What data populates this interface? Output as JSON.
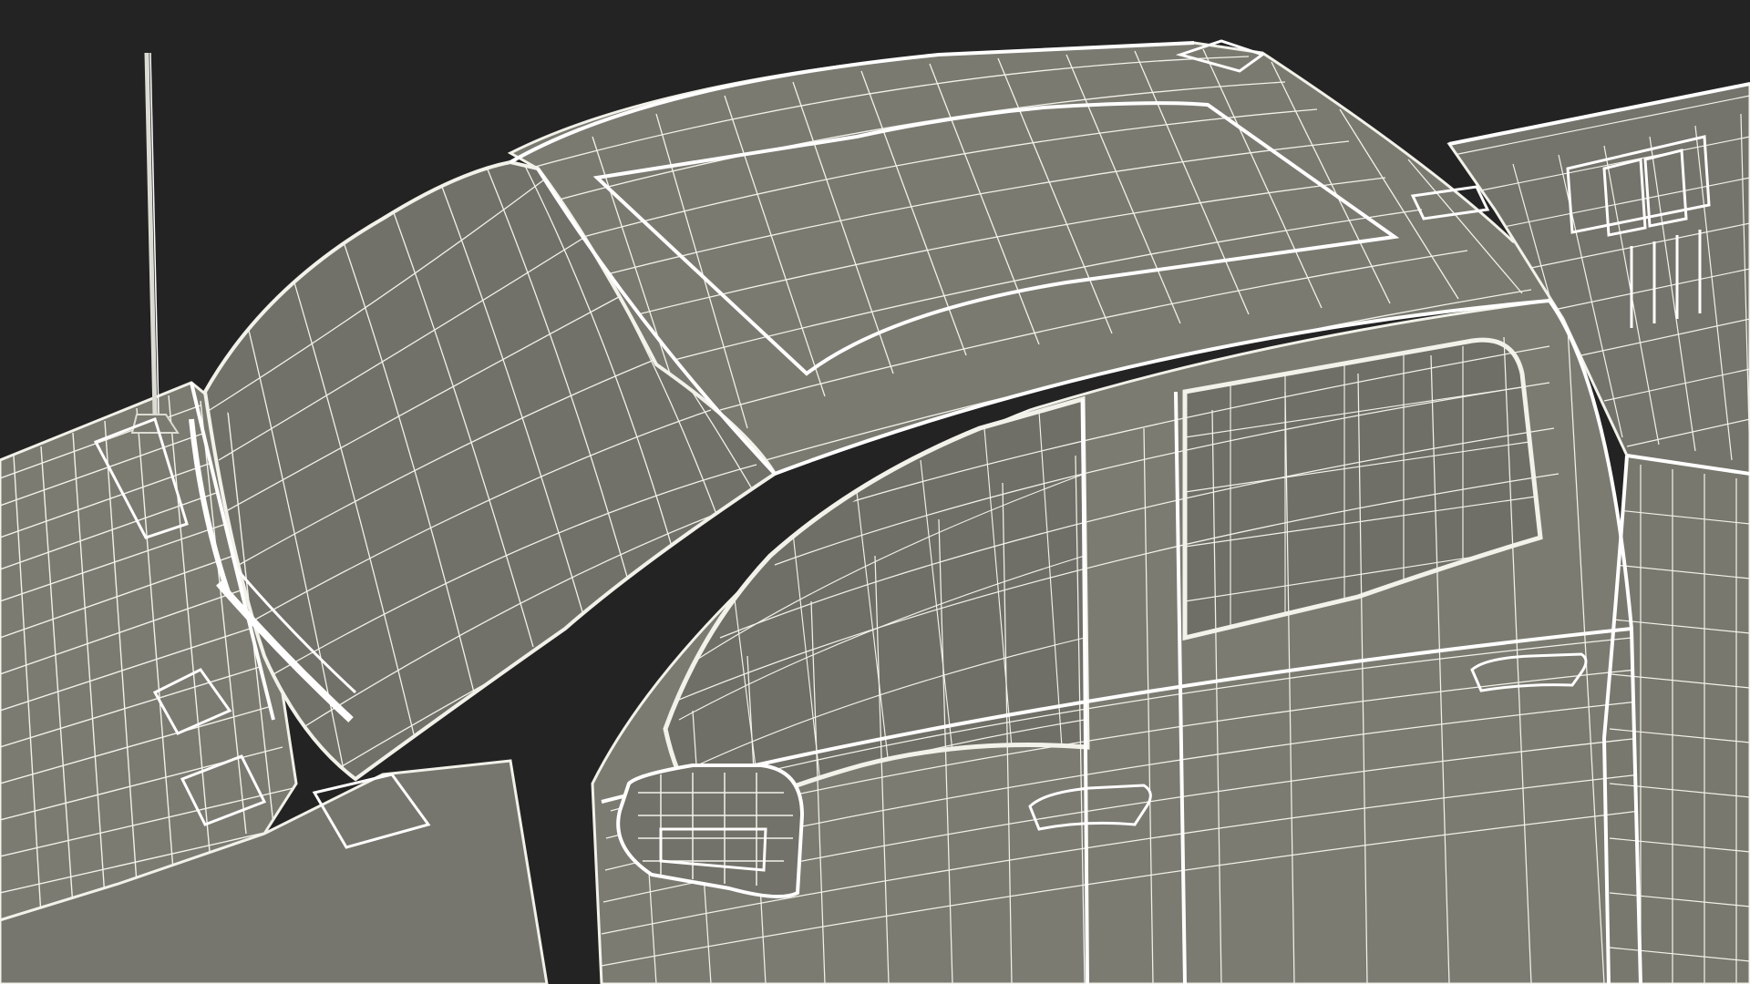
{
  "colors": {
    "background": "#232323",
    "body_fill": "#7b7b72",
    "glass_fill": "#6f6f67",
    "wire": "#f2f2ea",
    "wire_soft": "#d9d9cf",
    "wire_dense": "#ffffff",
    "shadow": "#5d5d56"
  },
  "icons": {
    "antenna": "antenna-icon",
    "mirror": "side-mirror-icon",
    "handle": "door-handle-icon",
    "wiper": "wiper-icon"
  }
}
